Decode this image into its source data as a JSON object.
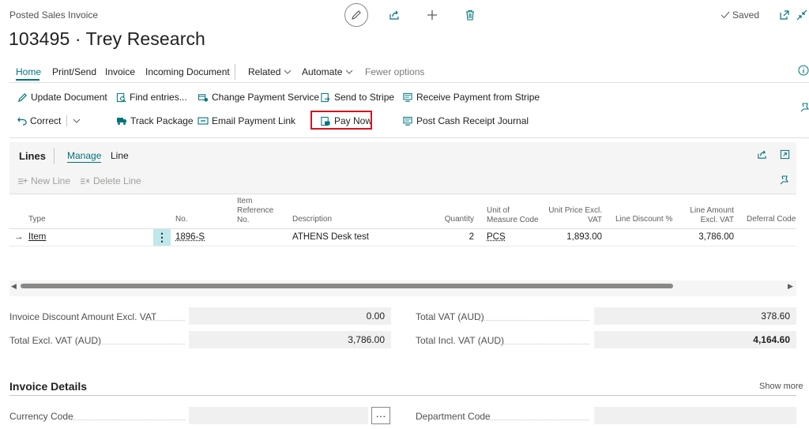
{
  "header": {
    "page_kind": "Posted Sales Invoice",
    "title": "103495 · Trey Research",
    "saved_label": "Saved"
  },
  "tabs": {
    "home": "Home",
    "print_send": "Print/Send",
    "invoice": "Invoice",
    "incoming_document": "Incoming Document",
    "related": "Related",
    "automate": "Automate",
    "fewer_options": "Fewer options"
  },
  "actions": {
    "update_document": "Update Document",
    "find_entries": "Find entries...",
    "change_payment_service": "Change Payment Service",
    "send_to_stripe": "Send to Stripe",
    "receive_payment_from_stripe": "Receive Payment from Stripe",
    "correct": "Correct",
    "track_package": "Track Package",
    "email_payment_link": "Email Payment Link",
    "pay_now": "Pay Now",
    "post_cash_receipt_journal": "Post Cash Receipt Journal"
  },
  "lines": {
    "title": "Lines",
    "manage": "Manage",
    "line": "Line",
    "new_line": "New Line",
    "delete_line": "Delete Line",
    "columns": {
      "type": "Type",
      "no": "No.",
      "item_reference_1": "Item",
      "item_reference_2": "Reference",
      "item_reference_3": "No.",
      "description": "Description",
      "quantity": "Quantity",
      "uom_1": "Unit of",
      "uom_2": "Measure Code",
      "unit_price_1": "Unit Price Excl.",
      "unit_price_2": "VAT",
      "line_discount": "Line Discount %",
      "line_amount_1": "Line Amount",
      "line_amount_2": "Excl. VAT",
      "deferral_code": "Deferral Code"
    },
    "rows": [
      {
        "type": "Item",
        "no": "1896-S",
        "description": "ATHENS Desk test",
        "quantity": "2",
        "uom": "PCS",
        "unit_price": "1,893.00",
        "line_amount": "3,786.00"
      }
    ]
  },
  "totals": {
    "inv_discount_label": "Invoice Discount Amount Excl. VAT",
    "inv_discount_value": "0.00",
    "total_excl_label": "Total Excl. VAT (AUD)",
    "total_excl_value": "3,786.00",
    "total_vat_label": "Total VAT (AUD)",
    "total_vat_value": "378.60",
    "total_incl_label": "Total Incl. VAT (AUD)",
    "total_incl_value": "4,164.60"
  },
  "invoice_details": {
    "title": "Invoice Details",
    "show_more": "Show more",
    "currency_code_label": "Currency Code",
    "currency_code_value": "",
    "ellipsis": "···",
    "department_code_label": "Department Code",
    "department_code_value": ""
  },
  "colors": {
    "accent": "#00747a",
    "highlight": "#d4141b"
  }
}
